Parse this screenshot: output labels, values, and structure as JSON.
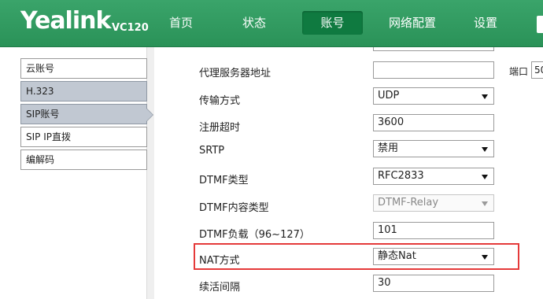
{
  "brand": {
    "logo": "Yealink",
    "model": "VC120"
  },
  "nav": [
    {
      "label": "首页"
    },
    {
      "label": "状态"
    },
    {
      "label": "账号",
      "active": true
    },
    {
      "label": "网络配置"
    },
    {
      "label": "设置"
    }
  ],
  "sidebar": {
    "items": [
      {
        "label": "云账号"
      },
      {
        "label": "H.323"
      },
      {
        "label": "SIP账号",
        "active": true
      },
      {
        "label": "SIP IP直拨"
      },
      {
        "label": "编解码"
      }
    ]
  },
  "form": {
    "proxy_server": {
      "label": "代理服务器地址",
      "value": ""
    },
    "port": {
      "label": "端口",
      "value": "50"
    },
    "transport": {
      "label": "传输方式",
      "value": "UDP"
    },
    "register_expire": {
      "label": "注册超时",
      "value": "3600"
    },
    "srtp": {
      "label": "SRTP",
      "value": "禁用"
    },
    "dtmf_type": {
      "label": "DTMF类型",
      "value": "RFC2833"
    },
    "dtmf_info_type": {
      "label": "DTMF内容类型",
      "value": "DTMF-Relay",
      "disabled": true
    },
    "dtmf_payload": {
      "label": "DTMF负载（96~127）",
      "value": "101"
    },
    "nat": {
      "label": "NAT方式",
      "value": "静态Nat"
    },
    "keepalive": {
      "label": "续活间隔",
      "value": "30"
    }
  },
  "colors": {
    "header_green": "#2a9258",
    "active_tab": "#0f7a40",
    "highlight_red": "#e53a3a",
    "sidebar_selected": "#c1c8d2"
  }
}
